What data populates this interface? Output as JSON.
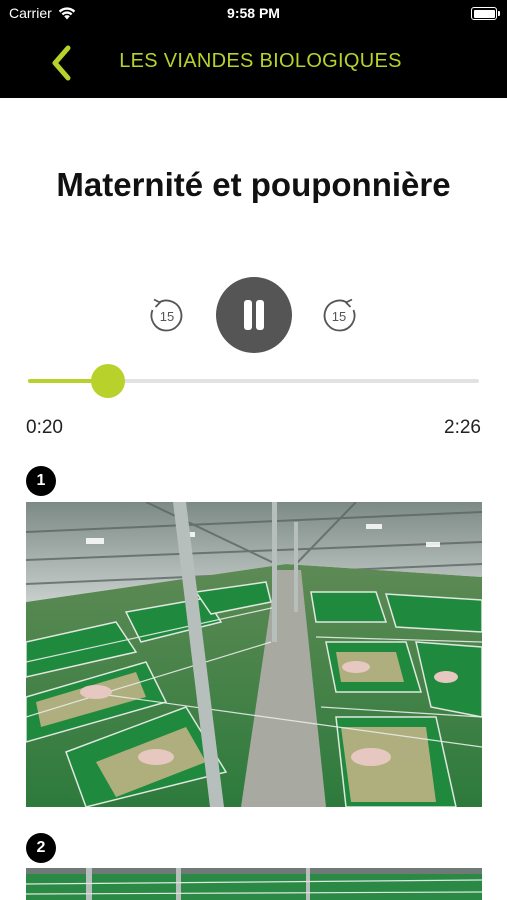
{
  "status_bar": {
    "carrier": "Carrier",
    "time": "9:58 PM"
  },
  "nav": {
    "title": "LES VIANDES BIOLOGIQUES",
    "back_icon": "chevron-left-icon"
  },
  "page": {
    "title": "Maternité et pouponnière"
  },
  "player": {
    "skip_back_label": "15",
    "skip_forward_label": "15",
    "state": "playing",
    "current_time": "0:20",
    "total_time": "2:26",
    "progress": 0.15
  },
  "steps": [
    {
      "number": "1"
    },
    {
      "number": "2"
    }
  ],
  "colors": {
    "accent": "#b8d22b",
    "button": "#555555",
    "bar": "#000000"
  }
}
